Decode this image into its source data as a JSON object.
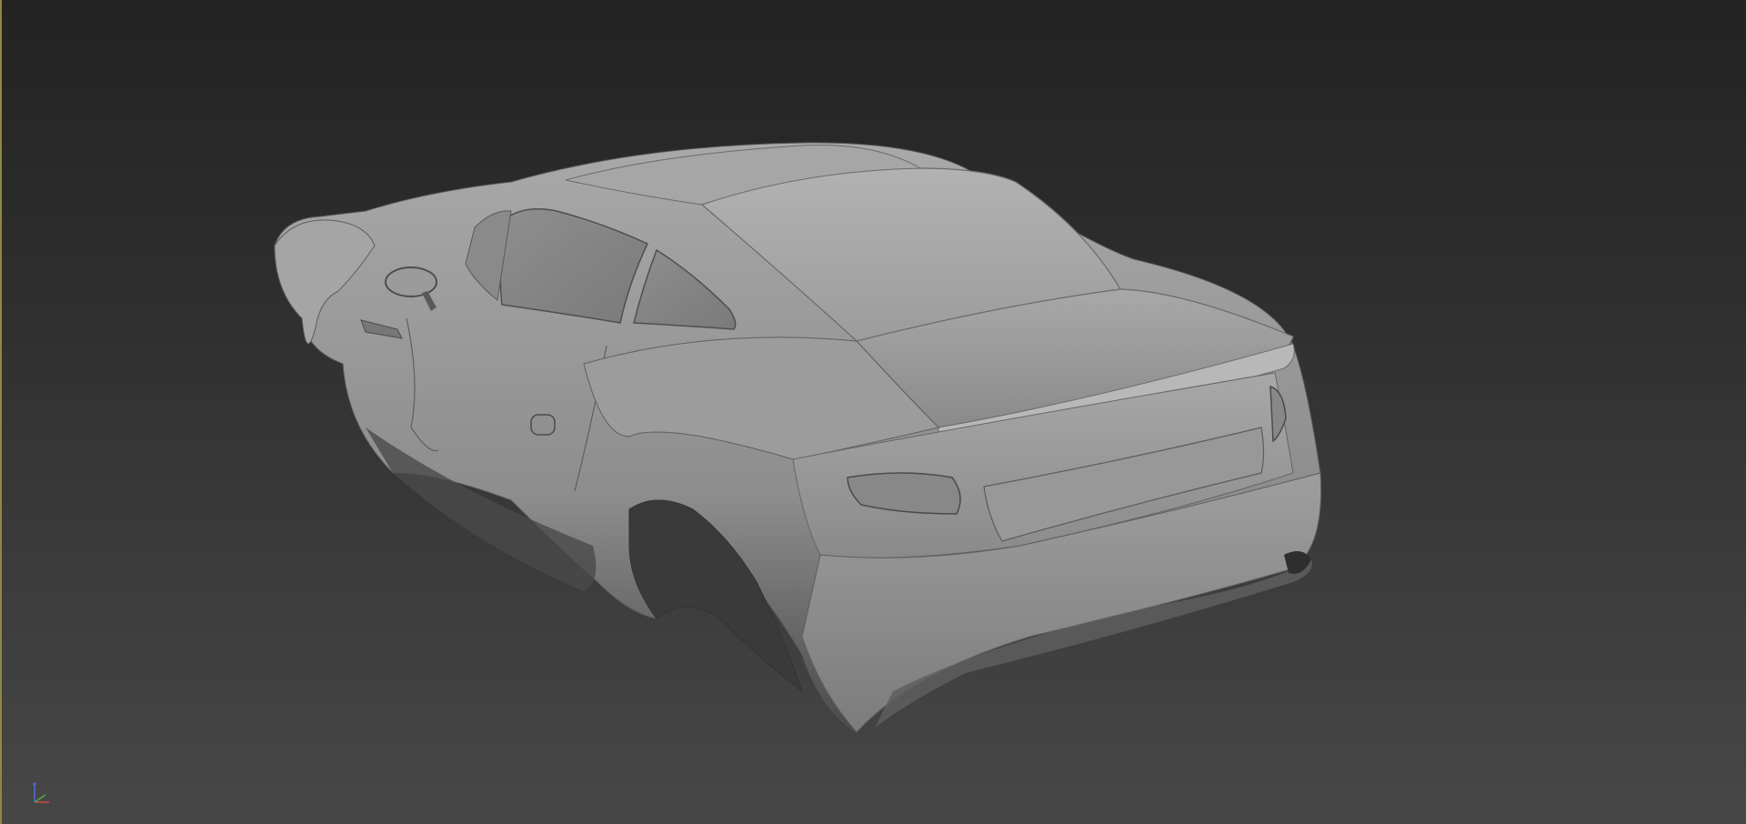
{
  "viewport": {
    "background_top": "#232323",
    "background_bottom": "#474747",
    "active_border_color": "#8d8a3e"
  },
  "model": {
    "object": "sports-car-body-shell",
    "shading": "clay-gray",
    "base_color": "#9a9a9a"
  },
  "gizmo": {
    "icon": "axis-tripod-icon",
    "x_color": "#c84a3a",
    "y_color": "#4cb040",
    "z_color": "#4a6ad8"
  }
}
